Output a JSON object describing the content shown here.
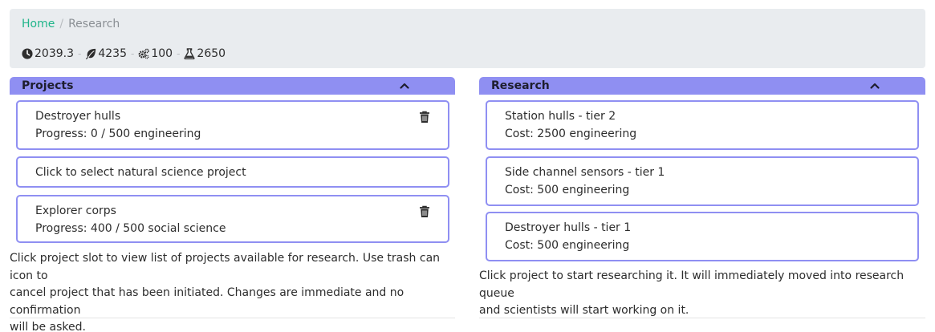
{
  "breadcrumb": {
    "home": "Home",
    "separator": "/",
    "current": "Research"
  },
  "stats": [
    {
      "icon": "clock-icon",
      "value": "2039.3"
    },
    {
      "icon": "leaf-icon",
      "value": "4235"
    },
    {
      "icon": "gears-icon",
      "value": "100"
    },
    {
      "icon": "flask-icon",
      "value": "2650"
    }
  ],
  "stat_separator": "-",
  "projects": {
    "title": "Projects",
    "slots": [
      {
        "name": "Destroyer hulls",
        "detail": "Progress: 0 / 500 engineering",
        "has_trash": true
      },
      {
        "name": "Click to select natural science project",
        "detail": "",
        "has_trash": false
      },
      {
        "name": "Explorer corps",
        "detail": "Progress: 400 / 500 social science",
        "has_trash": true
      }
    ],
    "help_lines": [
      "Click project slot to view list of projects available for research. Use trash can icon to",
      "cancel project that has been initiated. Changes are immediate and no confirmation",
      "will be asked."
    ]
  },
  "research": {
    "title": "Research",
    "items": [
      {
        "name": "Station hulls - tier 2",
        "cost": "Cost: 2500 engineering"
      },
      {
        "name": "Side channel sensors - tier 1",
        "cost": "Cost: 500 engineering"
      },
      {
        "name": "Destroyer hulls - tier 1",
        "cost": "Cost: 500 engineering"
      }
    ],
    "help_lines": [
      "Click project to start researching it. It will immediately moved into research queue",
      "and scientists will start working on it."
    ]
  },
  "colors": {
    "panel_header": "#8f8ff2",
    "card_border": "#8f8ff2",
    "link": "#20b58a",
    "topbar_bg": "#e9ecef"
  }
}
